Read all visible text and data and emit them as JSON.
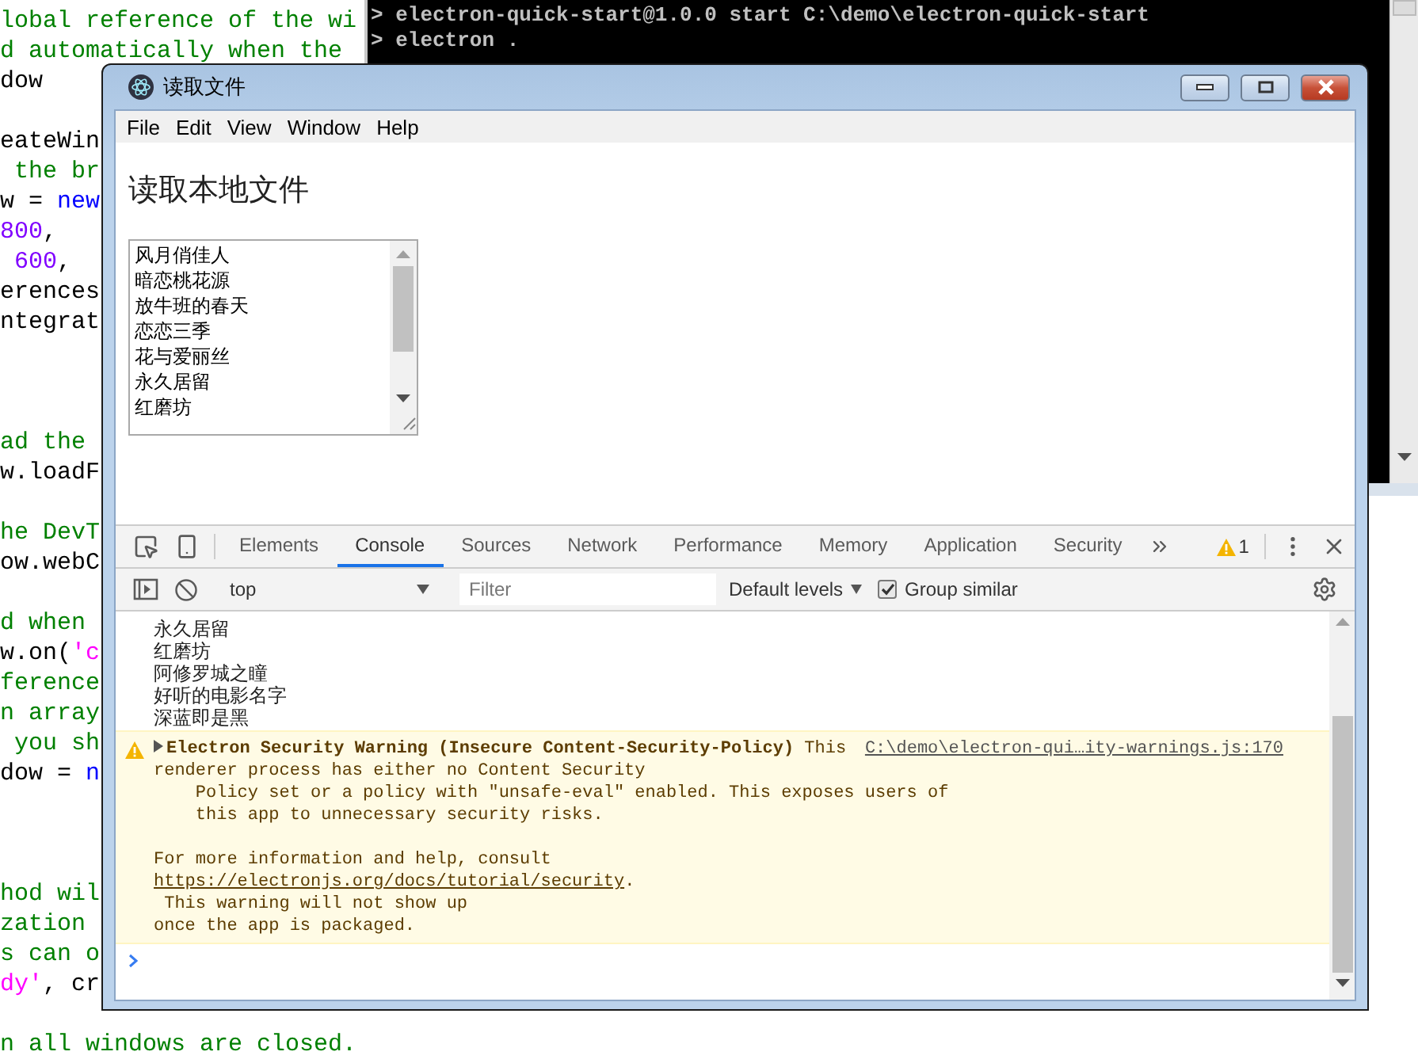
{
  "editor": {
    "lines": [
      {
        "kind": "code",
        "segments": [
          {
            "kind": "comment",
            "text": "lobal reference of the wi"
          }
        ]
      },
      {
        "kind": "code",
        "segments": [
          {
            "kind": "comment",
            "text": "d automatically when the"
          }
        ]
      },
      {
        "kind": "code",
        "segments": [
          {
            "kind": "plain",
            "text": "dow"
          }
        ]
      },
      {
        "kind": "blank"
      },
      {
        "kind": "code",
        "segments": [
          {
            "kind": "plain",
            "text": "eateWin"
          }
        ]
      },
      {
        "kind": "code",
        "segments": [
          {
            "kind": "comment",
            "text": " the br"
          }
        ]
      },
      {
        "kind": "code",
        "segments": [
          {
            "kind": "plain",
            "text": "w = "
          },
          {
            "kind": "keyword",
            "text": "new"
          }
        ]
      },
      {
        "kind": "code",
        "segments": [
          {
            "kind": "number",
            "text": "800"
          },
          {
            "kind": "plain",
            "text": ","
          }
        ]
      },
      {
        "kind": "code",
        "segments": [
          {
            "kind": "number",
            "text": " 600"
          },
          {
            "kind": "plain",
            "text": ","
          }
        ]
      },
      {
        "kind": "code",
        "segments": [
          {
            "kind": "plain",
            "text": "erences"
          }
        ]
      },
      {
        "kind": "code",
        "segments": [
          {
            "kind": "plain",
            "text": "ntegrat"
          }
        ]
      },
      {
        "kind": "blank"
      },
      {
        "kind": "blank"
      },
      {
        "kind": "blank"
      },
      {
        "kind": "code",
        "segments": [
          {
            "kind": "comment",
            "text": "ad the"
          }
        ]
      },
      {
        "kind": "code",
        "segments": [
          {
            "kind": "plain",
            "text": "w.loadF"
          }
        ]
      },
      {
        "kind": "blank"
      },
      {
        "kind": "code",
        "segments": [
          {
            "kind": "comment",
            "text": "he DevT"
          }
        ]
      },
      {
        "kind": "code",
        "segments": [
          {
            "kind": "plain",
            "text": "ow.webC"
          }
        ]
      },
      {
        "kind": "blank"
      },
      {
        "kind": "code",
        "segments": [
          {
            "kind": "comment",
            "text": "d when"
          }
        ]
      },
      {
        "kind": "code",
        "segments": [
          {
            "kind": "plain",
            "text": "w.on("
          },
          {
            "kind": "string",
            "text": "'c"
          }
        ]
      },
      {
        "kind": "code",
        "segments": [
          {
            "kind": "comment",
            "text": "ference"
          }
        ]
      },
      {
        "kind": "code",
        "segments": [
          {
            "kind": "comment",
            "text": "n array"
          }
        ]
      },
      {
        "kind": "code",
        "segments": [
          {
            "kind": "comment",
            "text": " you sh"
          }
        ]
      },
      {
        "kind": "code",
        "segments": [
          {
            "kind": "plain",
            "text": "dow = "
          },
          {
            "kind": "keyword",
            "text": "n"
          }
        ]
      },
      {
        "kind": "blank"
      },
      {
        "kind": "blank"
      },
      {
        "kind": "blank"
      },
      {
        "kind": "code",
        "segments": [
          {
            "kind": "comment",
            "text": "hod wil"
          }
        ]
      },
      {
        "kind": "code",
        "segments": [
          {
            "kind": "comment",
            "text": "zation"
          }
        ]
      },
      {
        "kind": "code",
        "segments": [
          {
            "kind": "comment",
            "text": "s can o"
          }
        ]
      },
      {
        "kind": "code",
        "segments": [
          {
            "kind": "string",
            "text": "dy'"
          },
          {
            "kind": "plain",
            "text": ", cr"
          }
        ]
      },
      {
        "kind": "blank"
      },
      {
        "kind": "code",
        "segments": [
          {
            "kind": "comment",
            "text": "n all windows are closed."
          }
        ]
      }
    ]
  },
  "terminal": {
    "lines": [
      "> electron-quick-start@1.0.0 start C:\\demo\\electron-quick-start",
      "> electron ."
    ]
  },
  "app_window": {
    "title": "读取文件",
    "menu": [
      "File",
      "Edit",
      "View",
      "Window",
      "Help"
    ],
    "page": {
      "heading": "读取本地文件",
      "list_items": [
        "风月俏佳人",
        "暗恋桃花源",
        "放牛班的春天",
        "恋恋三季",
        "花与爱丽丝",
        "永久居留",
        "红磨坊"
      ]
    },
    "devtools": {
      "tabs": [
        {
          "label": "Elements",
          "selected": false
        },
        {
          "label": "Console",
          "selected": true
        },
        {
          "label": "Sources",
          "selected": false
        },
        {
          "label": "Network",
          "selected": false
        },
        {
          "label": "Performance",
          "selected": false
        },
        {
          "label": "Memory",
          "selected": false
        },
        {
          "label": "Application",
          "selected": false
        },
        {
          "label": "Security",
          "selected": false
        }
      ],
      "warning_count": "1",
      "context": "top",
      "filter": {
        "placeholder": "Filter"
      },
      "levels": "Default levels",
      "group_similar": {
        "label": "Group similar",
        "checked": true
      },
      "console": {
        "logs": [
          "永久居留",
          "红磨坊",
          "阿修罗城之瞳",
          "好听的电影名字",
          "深蓝即是黑"
        ],
        "warning": {
          "headline": "**Electron Security Warning (Insecure Content-Security-Policy)** This",
          "message_start": "renderer process has either no Content Security\n    Policy set or a policy with \"unsafe-eval\" enabled. This exposes users of\n    this app to unnecessary security risks.\n\nFor more information and help, consult\n",
          "link": "https://electronjs.org/docs/tutorial/security",
          "message_end": ".\n This warning will not show up\nonce the app is packaged.",
          "source": "C:\\demo\\electron-qui…ity-warnings.js:170"
        }
      }
    }
  }
}
